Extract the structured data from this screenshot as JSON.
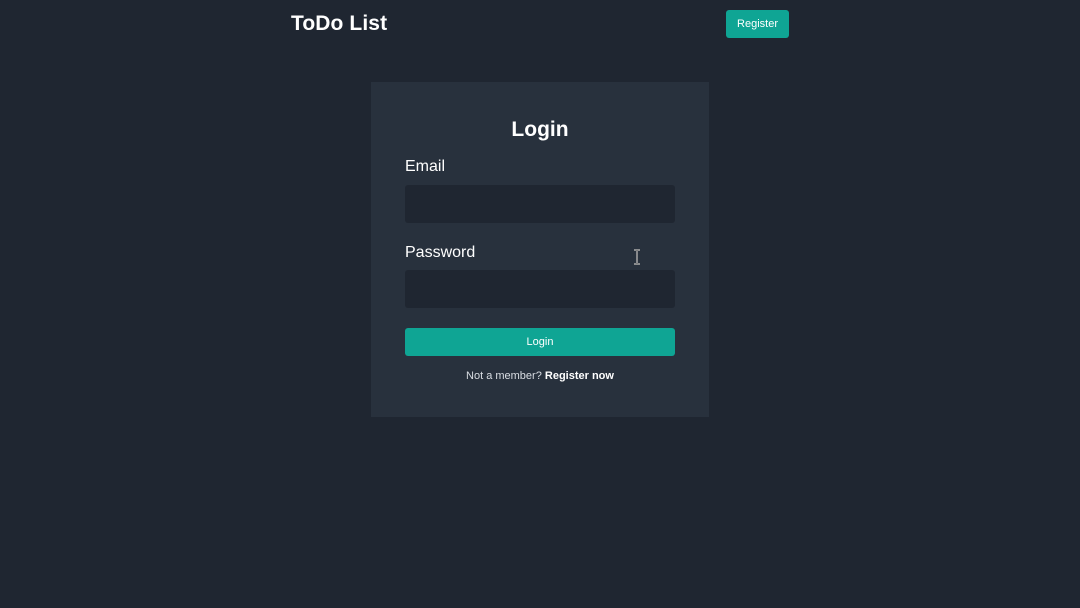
{
  "header": {
    "brand": "ToDo List",
    "register_label": "Register"
  },
  "login_form": {
    "title": "Login",
    "email_label": "Email",
    "email_value": "",
    "password_label": "Password",
    "password_value": "",
    "submit_label": "Login",
    "footer_prompt": "Not a member?",
    "footer_link": "Register now"
  },
  "colors": {
    "background": "#1f2631",
    "card": "#28313d",
    "accent": "#0fa594",
    "text": "#ffffff"
  },
  "icons": {
    "pointer": "text-cursor-icon"
  }
}
